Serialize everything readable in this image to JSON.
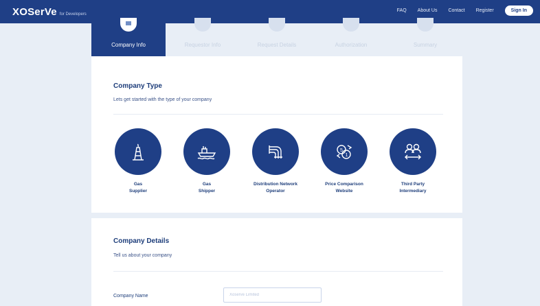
{
  "header": {
    "logo": "XOSerVe",
    "logo_sub": "for Developers",
    "links": [
      "FAQ",
      "About Us",
      "Contact",
      "Register"
    ],
    "signin": "Sign In"
  },
  "steps": [
    {
      "label": "Company Info",
      "active": true
    },
    {
      "label": "Requestor Info",
      "active": false
    },
    {
      "label": "Request Details",
      "active": false
    },
    {
      "label": "Authorization",
      "active": false
    },
    {
      "label": "Summary",
      "active": false
    }
  ],
  "company_type": {
    "title": "Company Type",
    "description": "Lets get started with the type of your company",
    "types": [
      {
        "line1": "Gas",
        "line2": "Supplier",
        "icon": "gas-rig-icon"
      },
      {
        "line1": "Gas",
        "line2": "Shipper",
        "icon": "ship-icon"
      },
      {
        "line1": "Distribution Network",
        "line2": "Operator",
        "icon": "pipes-icon"
      },
      {
        "line1": "Price Comparison",
        "line2": "Website",
        "icon": "coins-compare-icon"
      },
      {
        "line1": "Third Party",
        "line2": "Intermediary",
        "icon": "people-exchange-icon"
      }
    ]
  },
  "company_details": {
    "title": "Company Details",
    "description": "Tell us about your company",
    "company_name_label": "Company Name",
    "company_name_placeholder": "Xoserve Limited"
  }
}
